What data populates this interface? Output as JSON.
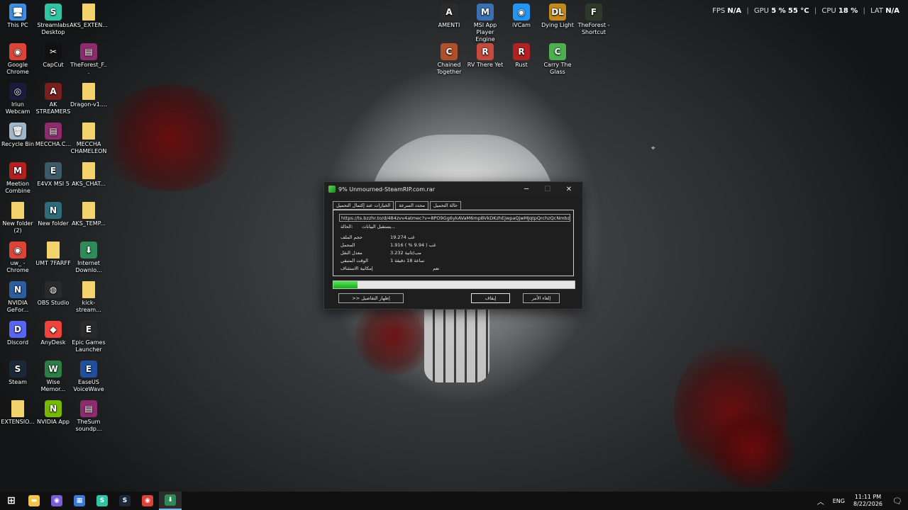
{
  "desktop_icons": [
    {
      "label": "This PC",
      "icon": "this-pc-icon",
      "color": "#3b8ee0",
      "glyph": "🖥"
    },
    {
      "label": "Streamlabs Desktop",
      "icon": "streamlabs-icon",
      "color": "#31c3a2",
      "glyph": "S"
    },
    {
      "label": "AKS_EXTEN...",
      "icon": "folder-icon",
      "color": "#f3d36b",
      "glyph": ""
    },
    {
      "label": "Google Chrome",
      "icon": "chrome-icon",
      "color": "#db4437",
      "glyph": "◉"
    },
    {
      "label": "CapCut",
      "icon": "capcut-icon",
      "color": "#111111",
      "glyph": "✂"
    },
    {
      "label": "TheForest_F...",
      "icon": "winrar-icon",
      "color": "#8e2b6c",
      "glyph": "▤"
    },
    {
      "label": "Iriun Webcam",
      "icon": "iriun-icon",
      "color": "#1b1b3a",
      "glyph": "◎"
    },
    {
      "label": "AK STREAMERS",
      "icon": "ak-streamers-icon",
      "color": "#7a1f1f",
      "glyph": "A"
    },
    {
      "label": "Dragon-v1....",
      "icon": "file-icon",
      "color": "#f3d36b",
      "glyph": ""
    },
    {
      "label": "Recycle Bin",
      "icon": "recycle-bin-icon",
      "color": "#9fb7c9",
      "glyph": "🗑"
    },
    {
      "label": "MECCHA.C...",
      "icon": "winrar-icon",
      "color": "#8e2b6c",
      "glyph": "▤"
    },
    {
      "label": "MECCHA CHAMELEON",
      "icon": "file-icon",
      "color": "#f3d36b",
      "glyph": ""
    },
    {
      "label": "Meetion Combine",
      "icon": "meetion-icon",
      "color": "#b32020",
      "glyph": "M"
    },
    {
      "label": "E4VX MSI 5",
      "icon": "e4vx-icon",
      "color": "#3d5a6b",
      "glyph": "E"
    },
    {
      "label": "AKS_CHAT...",
      "icon": "file-icon",
      "color": "#f3d36b",
      "glyph": ""
    },
    {
      "label": "New folder (2)",
      "icon": "folder-icon",
      "color": "#f3d36b",
      "glyph": ""
    },
    {
      "label": "New folder",
      "icon": "new-folder-icon",
      "color": "#2f6b7a",
      "glyph": "N"
    },
    {
      "label": "AKS_TEMP...",
      "icon": "file-icon",
      "color": "#f3d36b",
      "glyph": ""
    },
    {
      "label": "uw_ - Chrome",
      "icon": "chrome-icon",
      "color": "#db4437",
      "glyph": "◉"
    },
    {
      "label": "UMT 7FARFF",
      "icon": "folder-icon",
      "color": "#f3d36b",
      "glyph": ""
    },
    {
      "label": "Internet Downlo...",
      "icon": "idm-icon",
      "color": "#2e8b57",
      "glyph": "⬇"
    },
    {
      "label": "NVIDIA GeFor...",
      "icon": "nvidia-geforce-icon",
      "color": "#2c5d9e",
      "glyph": "N"
    },
    {
      "label": "OBS Studio",
      "icon": "obs-icon",
      "color": "#2a2a2a",
      "glyph": "◍"
    },
    {
      "label": "kick-stream...",
      "icon": "file-icon",
      "color": "#f3d36b",
      "glyph": ""
    },
    {
      "label": "Discord",
      "icon": "discord-icon",
      "color": "#5865f2",
      "glyph": "D"
    },
    {
      "label": "AnyDesk",
      "icon": "anydesk-icon",
      "color": "#ef443b",
      "glyph": "◆"
    },
    {
      "label": "Epic Games Launcher",
      "icon": "epic-games-icon",
      "color": "#2a2a2a",
      "glyph": "E"
    },
    {
      "label": "Steam",
      "icon": "steam-icon",
      "color": "#1b2838",
      "glyph": "S"
    },
    {
      "label": "Wise Memor...",
      "icon": "wise-memory-icon",
      "color": "#2d7d46",
      "glyph": "W"
    },
    {
      "label": "EaseUS VoiceWave",
      "icon": "easeus-icon",
      "color": "#1f4f9e",
      "glyph": "E"
    },
    {
      "label": "EXTENSIO...",
      "icon": "file-icon",
      "color": "#f3d36b",
      "glyph": ""
    },
    {
      "label": "NVIDIA App",
      "icon": "nvidia-app-icon",
      "color": "#76b900",
      "glyph": "N"
    },
    {
      "label": "TheSum soundp...",
      "icon": "winrar-icon",
      "color": "#8e2b6c",
      "glyph": "▤"
    }
  ],
  "top_icons": [
    {
      "label": "AMENTI",
      "icon": "amenti-icon",
      "color": "#2b2b2b",
      "glyph": "A"
    },
    {
      "label": "MSI App Player Engine",
      "icon": "msi-app-player-icon",
      "color": "#3a6fb0",
      "glyph": "M"
    },
    {
      "label": "iVCam",
      "icon": "ivcam-icon",
      "color": "#2196f3",
      "glyph": "◉"
    },
    {
      "label": "Dying Light",
      "icon": "dying-light-icon",
      "color": "#c28a1a",
      "glyph": "DL"
    },
    {
      "label": "TheForest - Shortcut",
      "icon": "the-forest-icon",
      "color": "#2d3a2a",
      "glyph": "F"
    },
    {
      "label": "Chained Together",
      "icon": "chained-together-icon",
      "color": "#b0502a",
      "glyph": "C"
    },
    {
      "label": "RV There Yet",
      "icon": "rv-there-yet-icon",
      "color": "#c44b3b",
      "glyph": "R"
    },
    {
      "label": "Rust",
      "icon": "rust-icon",
      "color": "#b22222",
      "glyph": "R"
    },
    {
      "label": "Carry The Glass",
      "icon": "carry-the-glass-icon",
      "color": "#4caf50",
      "glyph": "C"
    }
  ],
  "hud": {
    "fps_label": "FPS",
    "fps_value": "N/A",
    "gpu_label": "GPU",
    "gpu_load": "5 %",
    "gpu_temp": "55 °C",
    "cpu_label": "CPU",
    "cpu_load": "18 %",
    "lat_label": "LAT",
    "lat_value": "N/A"
  },
  "download_window": {
    "title": "9% Unmourned-SteamRIP.com.rar",
    "tabs": [
      "حالة التحميل",
      "محدد السرعة",
      "الخيارات عند إكتمال التحميل"
    ],
    "url": "https://ts.bzzhr.to/d/484zvv4atmec?v=8PO9Gg6ykAVaM6mpBVkDKzhEjwpaQjwMJqtpQrchzQcNmbz",
    "status_label": "الحالة:",
    "status_value": "يستقبل البيانات...",
    "rows": [
      {
        "key": "حجم الملف",
        "value": "19.274  غب"
      },
      {
        "key": "المحمل",
        "value": "1.916  غب  ( 9.94 % )"
      },
      {
        "key": "معدل النقل",
        "value": "3.232  مب/ثانية"
      },
      {
        "key": "الوقت المتبقي",
        "value": "1 ساعة 18 دقيقة"
      },
      {
        "key": "إمكانية الاستئناف",
        "value": "نعم"
      }
    ],
    "progress_percent": 9.94,
    "accent_color": "#12b312",
    "btn_details": ">> إظهار التفاصيل",
    "btn_pause": "إيقاف",
    "btn_cancel": "إلغاء الأمر"
  },
  "taskbar": {
    "items": [
      {
        "icon": "windows-start-icon",
        "color": "#ffffff",
        "glyph": "⊞"
      },
      {
        "icon": "file-explorer-icon",
        "color": "#f3c34a",
        "glyph": "▬"
      },
      {
        "icon": "browser-icon",
        "color": "#7b5cd6",
        "glyph": "◉"
      },
      {
        "icon": "task-manager-icon",
        "color": "#3a7bd5",
        "glyph": "▦"
      },
      {
        "icon": "streamlabs-taskbar-icon",
        "color": "#31c3a2",
        "glyph": "S"
      },
      {
        "icon": "steam-taskbar-icon",
        "color": "#1b2838",
        "glyph": "S"
      },
      {
        "icon": "chrome-taskbar-icon",
        "color": "#db4437",
        "glyph": "◉"
      },
      {
        "icon": "idm-taskbar-icon",
        "color": "#2e8b57",
        "glyph": "⬇"
      }
    ],
    "lang": "ENG",
    "time": "11:11 PM",
    "date": "8/22/2026"
  }
}
